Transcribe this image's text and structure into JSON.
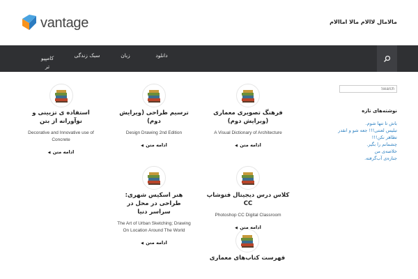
{
  "header": {
    "logo_text": "vantage",
    "tagline": "مالامال لاالام مالا اماالام"
  },
  "nav": {
    "items": [
      {
        "line1": "کامپیو",
        "line2": "تر"
      },
      {
        "line1": "سبک زندگی",
        "line2": ""
      },
      {
        "line1": "زبان",
        "line2": ""
      },
      {
        "line1": "دانلود",
        "line2": ""
      }
    ]
  },
  "posts": [
    {
      "title": "فرهنگ تصویری معماری (ویرایش دوم)",
      "desc": "A Visual Dictionary of Architecture",
      "more": "ادامه متن"
    },
    {
      "title": "ترسیم طراحی (ویرایش دوم)",
      "desc": "Design Drawing 2nd Edition",
      "more": "ادامه متن"
    },
    {
      "title": "استفاده ی تزیینی و نوآورانه از بتن",
      "desc": "Decorative and Innovative use of Concrete",
      "more": "ادامه متن"
    },
    {
      "title": "کلاس درس دیجیتال فتوشاپ CC",
      "desc": "Photoshop CC Digital Classroom",
      "more": "ادامه متن"
    },
    {
      "title": "هنر اسکیس شهری: طراحی در محل در سراسر دنیا",
      "desc": "The Art of Urban Sketching; Drawing On Location Around The World",
      "more": "ادامه متن"
    },
    {
      "title": "فهرست کتاب‌های معماری",
      "desc": "",
      "more": ""
    }
  ],
  "sidebar": {
    "search_placeholder": "Search",
    "widget_title": "نوشته‌های تازه",
    "recent": [
      "باش تا تنها شوم.",
      "تبلیس لعنتی!!! جعه شو و انقدر تظاهر نکن!!!",
      "چشمانم را بگیر.",
      "خلاصه‌ی من",
      "جنازه‌ی آب‌گرفته."
    ]
  },
  "colors": {
    "nav_bg": "#2f3033",
    "link": "#2a7fc1",
    "logo_orange": "#f7931e",
    "logo_blue": "#2b7bc0"
  }
}
